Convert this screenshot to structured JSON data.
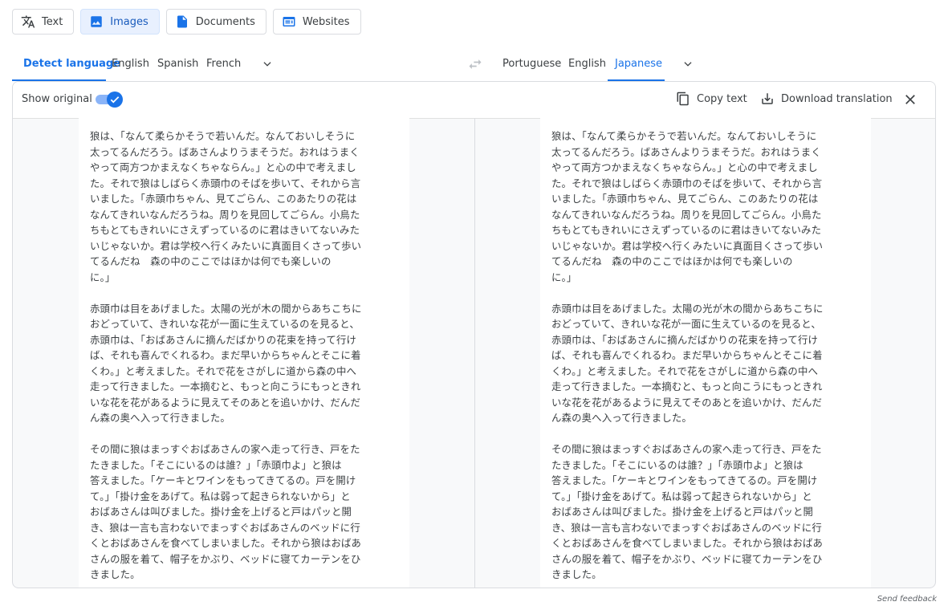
{
  "modes": [
    {
      "label": "Text",
      "icon": "translate-icon",
      "active": false
    },
    {
      "label": "Images",
      "icon": "image-icon",
      "active": true
    },
    {
      "label": "Documents",
      "icon": "document-icon",
      "active": false
    },
    {
      "label": "Websites",
      "icon": "website-icon",
      "active": false
    }
  ],
  "source_langs": [
    "Detect language",
    "English",
    "Spanish",
    "French"
  ],
  "source_active": "Detect language",
  "target_langs": [
    "Portuguese",
    "English",
    "Japanese"
  ],
  "target_active": "Japanese",
  "toolbar": {
    "show_original": "Show original",
    "show_original_on": true,
    "copy_text": "Copy text",
    "download": "Download translation"
  },
  "paragraphs": [
    "狼は、「なんて柔らかそうで若いんだ。なんておいしそうに\n太ってるんだろう。ばあさんよりうまそうだ。おれはうまく\nやって両方つかまえなくちゃならん。」と心の中で考えまし\nた。それで狼はしばらく赤頭巾のそばを歩いて、それから言\nいました。「赤頭巾ちゃん、見てごらん、このあたりの花は\nなんてきれいなんだろうね。周りを見回してごらん。小鳥た\nちもとてもきれいにさえずっているのに君はきいてないみた\nいじゃないか。君は学校へ行くみたいに真面目くさって歩い\nてるんだね　森の中のここではほかは何でも楽しいの\nに。」",
    "赤頭巾は目をあげました。太陽の光が木の間からあちこちに\nおどっていて、きれいな花が一面に生えているのを見ると、\n赤頭巾は、「おばあさんに摘んだばかりの花束を持って行け\nば、それも喜んでくれるわ。まだ早いからちゃんとそこに着\nくわ。」と考えました。それで花をさがしに道から森の中へ\n走って行きました。一本摘むと、もっと向こうにもっときれ\nいな花を花があるように見えてそのあとを追いかけ、だんだ\nん森の奥へ入って行きました。",
    "その間に狼はまっすぐおばあさんの家へ走って行き、戸をた\nたきました。「そこにいるのは誰？」「赤頭巾よ」と狼は\n答えました。「ケーキとワインをもってきてるの。戸を開け\nて。」「掛け金をあげて。私は弱って起きられないから」と\nおばあさんは叫びました。掛け金を上げると戸はパッと開\nき、狼は一言も言わないでまっすぐおばあさんのベッドに行\nくとおばあさんを食べてしまいました。それから狼はおばあ\nさんの服を着て、帽子をかぶり、ベッドに寝てカーテンをひ\nきました。"
  ],
  "footer": {
    "send_feedback": "Send feedback"
  },
  "colors": {
    "accent": "#1a73e8",
    "active_tab_bg": "#e8f0fe",
    "panel_bg": "#f8f9fa"
  }
}
